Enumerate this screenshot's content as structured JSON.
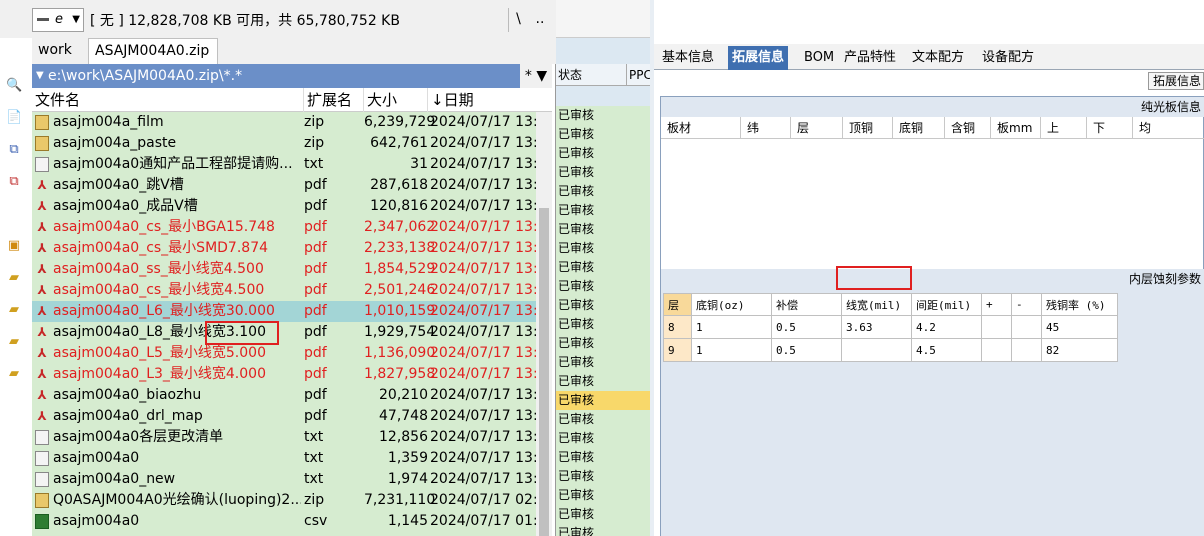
{
  "left_panel": {
    "drive": "e",
    "disk_info": "[ 无 ]  12,828,708 KB 可用，共 65,780,752 KB",
    "root_label": "\\",
    "up_label": "..",
    "tabs": [
      "work",
      "ASAJM004A0.zip"
    ],
    "path": "e:\\work\\ASAJM004A0.zip\\*.*",
    "filter": "*",
    "columns": {
      "name": "文件名",
      "ext": "扩展名",
      "size": "大小",
      "date": "↓日期"
    },
    "files": [
      {
        "name": "asajm004a_film",
        "ext": "zip",
        "size": "6,239,729",
        "date": "2024/07/17 13:3",
        "icon": "zip",
        "red": false
      },
      {
        "name": "asajm004a_paste",
        "ext": "zip",
        "size": "642,761",
        "date": "2024/07/17 13:3",
        "icon": "zip",
        "red": false
      },
      {
        "name": "asajm004a0通知产品工程部提请购...",
        "ext": "txt",
        "size": "31",
        "date": "2024/07/17 13:2",
        "icon": "txt",
        "red": false
      },
      {
        "name": "asajm004a0_跳V槽",
        "ext": "pdf",
        "size": "287,618",
        "date": "2024/07/17 13:1",
        "icon": "pdf",
        "red": false
      },
      {
        "name": "asajm004a0_成品V槽",
        "ext": "pdf",
        "size": "120,816",
        "date": "2024/07/17 13:1",
        "icon": "pdf",
        "red": false
      },
      {
        "name": "asajm004a0_cs_最小BGA15.748",
        "ext": "pdf",
        "size": "2,347,062",
        "date": "2024/07/17 13:1",
        "icon": "pdf",
        "red": true
      },
      {
        "name": "asajm004a0_cs_最小SMD7.874",
        "ext": "pdf",
        "size": "2,233,138",
        "date": "2024/07/17 13:1",
        "icon": "pdf",
        "red": true
      },
      {
        "name": "asajm004a0_ss_最小线宽4.500",
        "ext": "pdf",
        "size": "1,854,529",
        "date": "2024/07/17 13:1",
        "icon": "pdf",
        "red": true
      },
      {
        "name": "asajm004a0_cs_最小线宽4.500",
        "ext": "pdf",
        "size": "2,501,246",
        "date": "2024/07/17 13:1",
        "icon": "pdf",
        "red": true
      },
      {
        "name": "asajm004a0_L6_最小线宽30.000",
        "ext": "pdf",
        "size": "1,010,159",
        "date": "2024/07/17 13:1",
        "icon": "pdf",
        "red": true,
        "selected": true
      },
      {
        "name": "asajm004a0_L8_最小线宽3.100",
        "ext": "pdf",
        "size": "1,929,754",
        "date": "2024/07/17 13:1",
        "icon": "pdf",
        "red": false
      },
      {
        "name": "asajm004a0_L5_最小线宽5.000",
        "ext": "pdf",
        "size": "1,136,090",
        "date": "2024/07/17 13:1",
        "icon": "pdf",
        "red": true
      },
      {
        "name": "asajm004a0_L3_最小线宽4.000",
        "ext": "pdf",
        "size": "1,827,958",
        "date": "2024/07/17 13:1",
        "icon": "pdf",
        "red": true
      },
      {
        "name": "asajm004a0_biaozhu",
        "ext": "pdf",
        "size": "20,210",
        "date": "2024/07/17 13:1",
        "icon": "pdf",
        "red": false
      },
      {
        "name": "asajm004a0_drl_map",
        "ext": "pdf",
        "size": "47,748",
        "date": "2024/07/17 13:1",
        "icon": "pdf",
        "red": false
      },
      {
        "name": "asajm004a0各层更改清单",
        "ext": "txt",
        "size": "12,856",
        "date": "2024/07/17 13:1",
        "icon": "txt",
        "red": false
      },
      {
        "name": "asajm004a0",
        "ext": "txt",
        "size": "1,359",
        "date": "2024/07/17 13:1",
        "icon": "txt",
        "red": false
      },
      {
        "name": "asajm004a0_new",
        "ext": "txt",
        "size": "1,974",
        "date": "2024/07/17 13:1",
        "icon": "txt",
        "red": false
      },
      {
        "name": "Q0ASAJM004A0光绘确认(luoping)2...",
        "ext": "zip",
        "size": "7,231,110",
        "date": "2024/07/17 02:0",
        "icon": "zip",
        "red": false
      },
      {
        "name": "asajm004a0",
        "ext": "csv",
        "size": "1,145",
        "date": "2024/07/17 01:4",
        "icon": "csv",
        "red": false
      }
    ]
  },
  "middle_panel": {
    "col_status": "状态",
    "col_ppc": "PPC",
    "status_value": "已审核",
    "row_count": 23
  },
  "right_panel": {
    "tabs": [
      "基本信息",
      "拓展信息",
      "BOM",
      "产品特性",
      "文本配方",
      "设备配方"
    ],
    "active_tab": 1,
    "ext_button": "拓展信息",
    "board_section": "纯光板信息",
    "board_headers": [
      "板材",
      "纬",
      "层",
      "顶铜",
      "底铜",
      "含铜",
      "板mm",
      "上",
      "下",
      "均"
    ],
    "inner_section": "内层蚀刻参数",
    "layer_headers": [
      "层",
      "底铜(oz)",
      "补偿",
      "线宽(mil)",
      "间距(mil)",
      "+",
      "-",
      "残铜率 (%)"
    ],
    "layer_rows": [
      [
        "8",
        "1",
        "0.5",
        "3.63",
        "4.2",
        "",
        "",
        "45"
      ],
      [
        "9",
        "1",
        "0.5",
        "",
        "4.5",
        "",
        "",
        "82"
      ]
    ]
  },
  "colors": {
    "list_bg": "#d6ecd0",
    "selected_row": "#a3d5d6",
    "red_text": "#e02020",
    "path_bar": "#6b8fc8",
    "active_tab": "#3f6fb0",
    "highlight_status": "#f8d86a"
  }
}
